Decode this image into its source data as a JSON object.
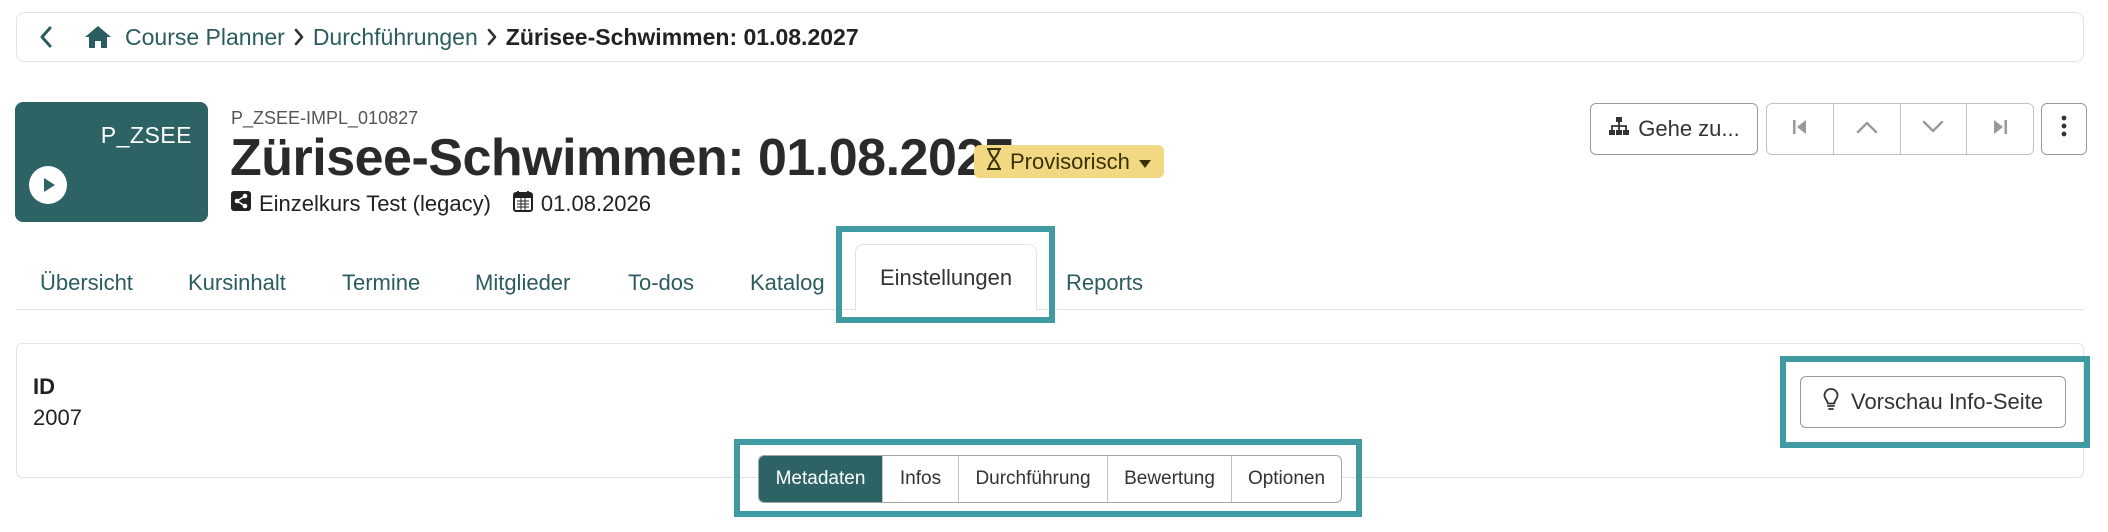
{
  "breadcrumb": {
    "items": [
      "Course Planner",
      "Durchführungen"
    ],
    "current": "Zürisee-Schwimmen: 01.08.2027"
  },
  "course": {
    "thumb_code": "P_ZSEE",
    "external_id": "P_ZSEE-IMPL_010827",
    "title": "Zürisee-Schwimmen: 01.08.2027",
    "status": "Provisorisch",
    "type": "Einzelkurs Test (legacy)",
    "date": "01.08.2026"
  },
  "toolbar": {
    "goto_label": "Gehe zu..."
  },
  "tabs": [
    "Übersicht",
    "Kursinhalt",
    "Termine",
    "Mitglieder",
    "To-dos",
    "Katalog",
    "Einstellungen",
    "Reports"
  ],
  "active_tab": "Einstellungen",
  "settings": {
    "id_label": "ID",
    "id_value": "2007",
    "preview_label": "Vorschau Info-Seite"
  },
  "segments": [
    "Metadaten",
    "Infos",
    "Durchführung",
    "Bewertung",
    "Optionen"
  ],
  "active_segment": "Metadaten",
  "colors": {
    "brand": "#2e6366",
    "link": "#2b5c5f",
    "status_badge": "#f3d884",
    "highlight": "#3f9aa1"
  }
}
